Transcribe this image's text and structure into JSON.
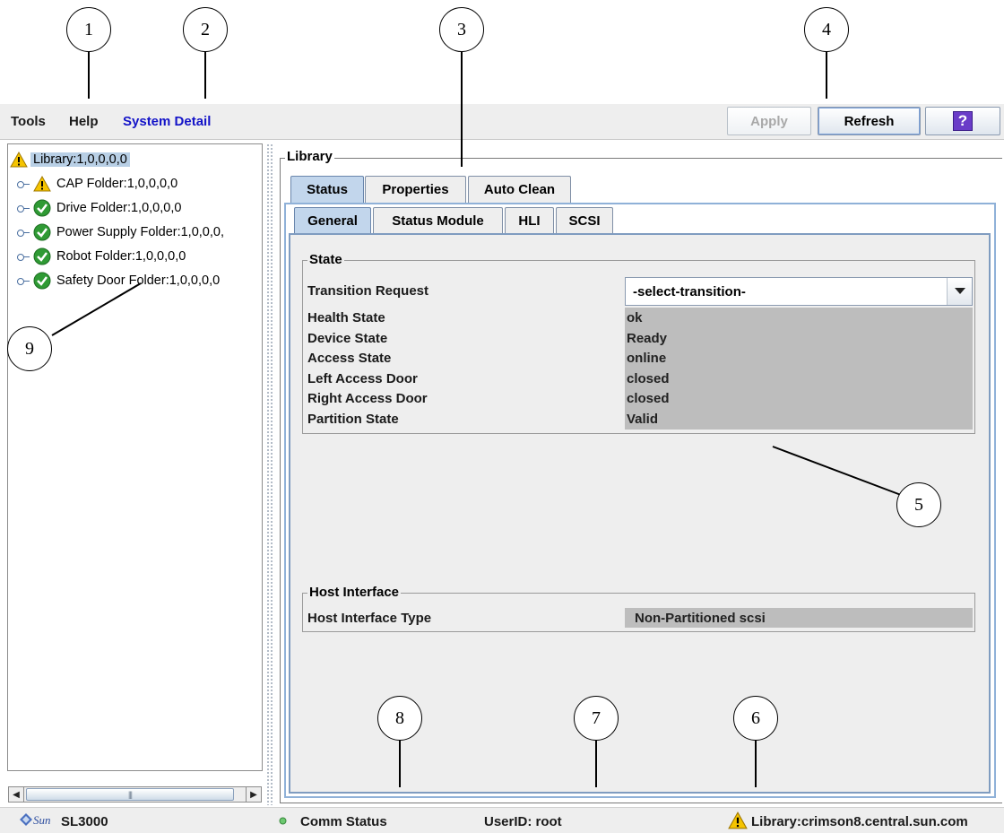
{
  "menu": {
    "tools": "Tools",
    "help": "Help",
    "system_detail": "System Detail"
  },
  "toolbar": {
    "apply": "Apply",
    "refresh": "Refresh",
    "help_glyph": "?"
  },
  "tree": {
    "root": "Library:1,0,0,0,0",
    "items": [
      {
        "label": "CAP Folder:1,0,0,0,0",
        "status": "warning"
      },
      {
        "label": "Drive Folder:1,0,0,0,0",
        "status": "ok"
      },
      {
        "label": "Power Supply Folder:1,0,0,0,",
        "status": "ok"
      },
      {
        "label": "Robot Folder:1,0,0,0,0",
        "status": "ok"
      },
      {
        "label": "Safety Door Folder:1,0,0,0,0",
        "status": "ok"
      }
    ],
    "scroll_thumb_grip": "|||"
  },
  "panel": {
    "title": "Library",
    "tabs": [
      "Status",
      "Properties",
      "Auto Clean"
    ],
    "subtabs": [
      "General",
      "Status Module",
      "HLI",
      "SCSI"
    ],
    "state": {
      "title": "State",
      "transition_label": "Transition Request",
      "transition_value": "-select-transition-",
      "rows": [
        {
          "label": "Health State",
          "value": "ok"
        },
        {
          "label": "Device State",
          "value": "Ready"
        },
        {
          "label": "Access State",
          "value": "online"
        },
        {
          "label": "Left Access Door",
          "value": "closed"
        },
        {
          "label": "Right Access Door",
          "value": "closed"
        },
        {
          "label": "Partition State",
          "value": "Valid"
        }
      ]
    },
    "host": {
      "title": "Host Interface",
      "label": "Host Interface Type",
      "value": "Non-Partitioned scsi"
    }
  },
  "status_bar": {
    "logo_text": "Sun",
    "product": "SL3000",
    "comm": "Comm Status",
    "user": "UserID: root",
    "library": "Library:crimson8.central.sun.com"
  },
  "callouts": [
    "1",
    "2",
    "3",
    "4",
    "5",
    "6",
    "7",
    "8",
    "9"
  ],
  "colors": {
    "accent": "#1414c8",
    "selected_tab": "#c2d6ec",
    "value_bg": "#bdbdbd",
    "warning": "#f5c400",
    "ok": "#2f9a34"
  }
}
